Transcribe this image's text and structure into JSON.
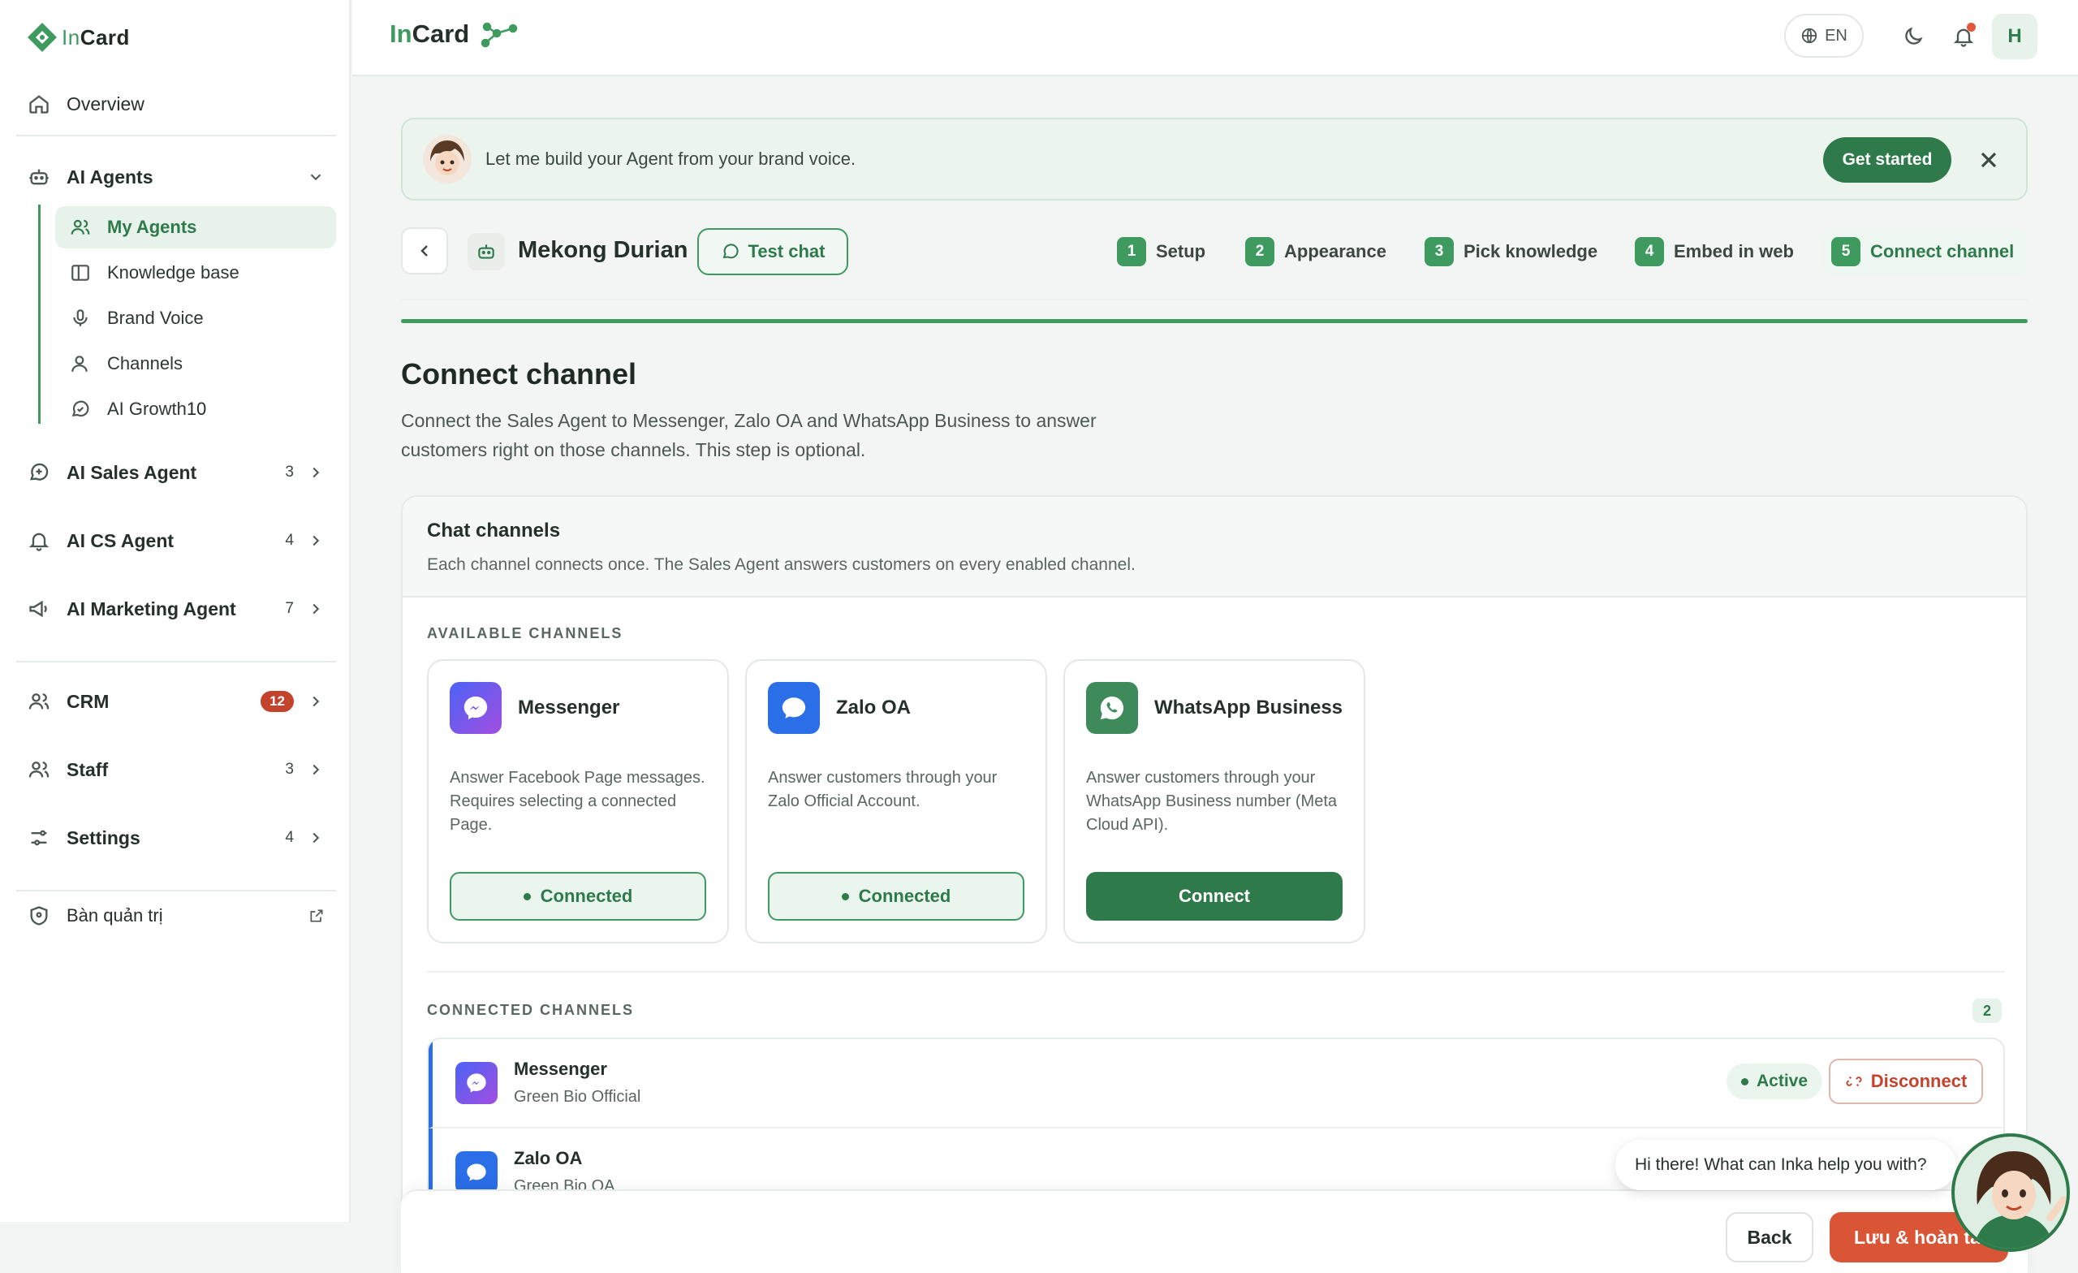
{
  "logo": {
    "prefix": "In",
    "suffix": "Card"
  },
  "header": {
    "brand_prefix": "In",
    "brand_suffix": "Card",
    "lang": "EN",
    "user_initial": "H"
  },
  "sidebar": {
    "overview": "Overview",
    "ai_agents": {
      "label": "AI Agents",
      "children": [
        {
          "label": "My Agents"
        },
        {
          "label": "Knowledge base"
        },
        {
          "label": "Brand Voice"
        },
        {
          "label": "Channels"
        },
        {
          "label": "AI Growth",
          "badge": "10"
        }
      ]
    },
    "ai_sales": {
      "label": "AI Sales Agent",
      "count": "3"
    },
    "ai_cs": {
      "label": "AI CS Agent",
      "count": "4"
    },
    "ai_marketing": {
      "label": "AI Marketing Agent",
      "count": "7"
    },
    "crm": {
      "label": "CRM",
      "badge": "12"
    },
    "staff": {
      "label": "Staff",
      "count": "3"
    },
    "settings": {
      "label": "Settings",
      "count": "4"
    },
    "admin": "Bàn quản trị"
  },
  "banner": {
    "text": "Let me build your Agent from your brand voice.",
    "cta": "Get started"
  },
  "agent": {
    "name": "Mekong Durian",
    "test_chat": "Test chat"
  },
  "steps": [
    {
      "num": "1",
      "label": "Setup"
    },
    {
      "num": "2",
      "label": "Appearance"
    },
    {
      "num": "3",
      "label": "Pick knowledge"
    },
    {
      "num": "4",
      "label": "Embed in web"
    },
    {
      "num": "5",
      "label": "Connect channel"
    }
  ],
  "progress": 1.0,
  "page": {
    "title": "Connect channel",
    "description": "Connect the Sales Agent to Messenger, Zalo OA and WhatsApp Business to answer customers right on those channels. This step is optional."
  },
  "card": {
    "title": "Chat channels",
    "subtitle": "Each channel connects once. The Sales Agent answers customers on every enabled channel.",
    "available_label": "AVAILABLE CHANNELS",
    "connected_label": "CONNECTED CHANNELS",
    "connected_count": "2"
  },
  "channels": [
    {
      "name": "Messenger",
      "desc": "Answer Facebook Page messages. Requires selecting a connected Page.",
      "action": "Connected",
      "color": "#7b4ff0"
    },
    {
      "name": "Zalo OA",
      "desc": "Answer customers through your Zalo Official Account.",
      "action": "Connected",
      "color": "#2a6ee8"
    },
    {
      "name": "WhatsApp Business",
      "desc": "Answer customers through your WhatsApp Business number (Meta Cloud API).",
      "action": "Connect",
      "color": "#2f7a4a"
    }
  ],
  "connected": [
    {
      "name": "Messenger",
      "account": "Green Bio Official",
      "status": "Active",
      "action": "Disconnect"
    },
    {
      "name": "Zalo OA",
      "account": "Green Bio OA"
    }
  ],
  "footer": {
    "back": "Back",
    "save": "Lưu & hoàn tất"
  },
  "chat": {
    "greeting": "Hi there! What can Inka help you with?"
  }
}
